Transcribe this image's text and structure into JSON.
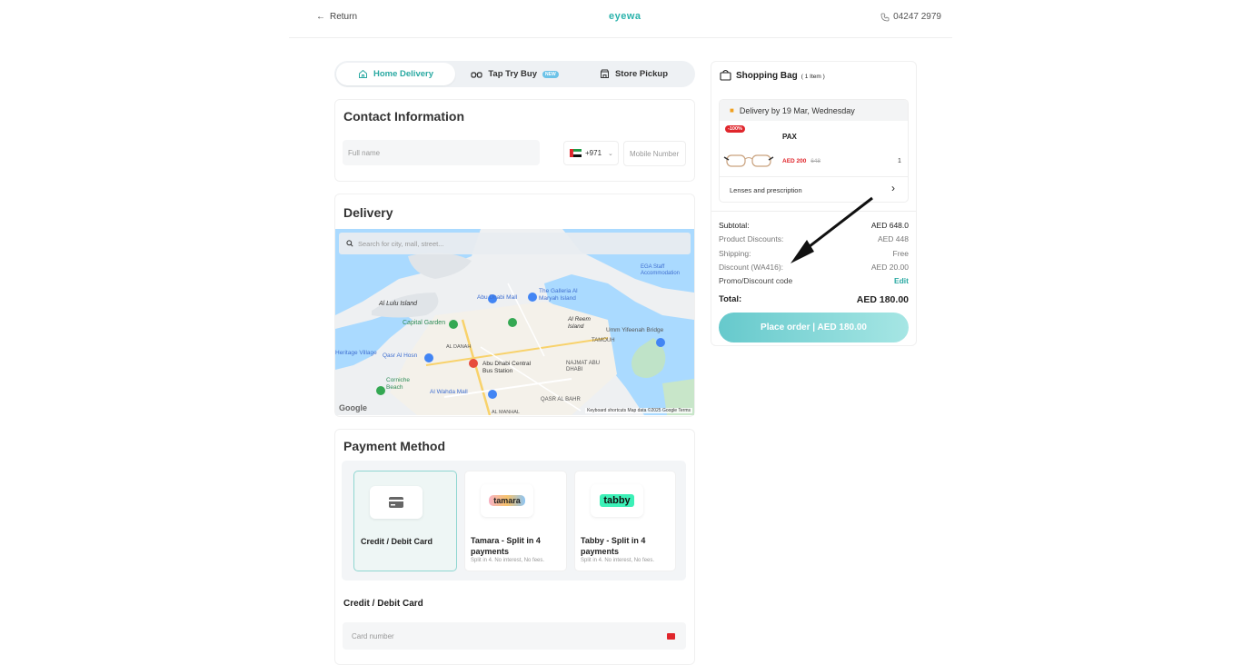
{
  "header": {
    "return_label": "Return",
    "logo": "eyewa",
    "phone": "04247 2979"
  },
  "tabs": [
    {
      "label": "Home Delivery",
      "icon": "home-icon",
      "active": true
    },
    {
      "label": "Tap Try Buy",
      "icon": "glasses-icon",
      "badge": "NEW",
      "active": false
    },
    {
      "label": "Store Pickup",
      "icon": "store-icon",
      "active": false
    }
  ],
  "contact": {
    "title": "Contact Information",
    "fullname_placeholder": "Full name",
    "country_code": "+971",
    "mobile_placeholder": "Mobile Number"
  },
  "delivery": {
    "title": "Delivery",
    "search_placeholder": "Search for city, mall, street...",
    "map_labels": {
      "lulu": "Al Lulu Island",
      "capital": "Capital Garden",
      "galleria": "The Galleria Al Maryah Island",
      "reem": "Al Reem Island",
      "mall": "Abu Dhabi Mall",
      "bus": "Abu Dhabi Central Bus Station",
      "najmat": "NAJMAT ABU DHABI",
      "tamouh": "TAMOUH",
      "wahda": "Al Wahda Mall",
      "corniche": "Corniche Beach",
      "qasr": "QASR AL BAHR",
      "qasr_hosn": "Qasr Al Hosn",
      "umm": "Umm Yifeenah Bridge",
      "village": "Heritage Village",
      "danah": "AL DANAH",
      "manhal": "AL MANHAL",
      "eg": "EGA Staff Accommodation",
      "footer": "Keyboard shortcuts   Map data ©2025 Google   Terms",
      "google": "Google"
    }
  },
  "payment": {
    "title": "Payment Method",
    "options": [
      {
        "label": "Credit / Debit Card",
        "sub": "",
        "active": true
      },
      {
        "label": "Tamara - Split in 4 payments",
        "brand": "tamara",
        "sub": "Split in 4. No interest, No fees."
      },
      {
        "label": "Tabby - Split in 4 payments",
        "brand": "tabby",
        "sub": "Split in 4. No interest, No fees."
      }
    ],
    "card_title": "Credit / Debit Card",
    "card_placeholder": "Card number"
  },
  "bag": {
    "title": "Shopping Bag",
    "count": "( 1 Item )",
    "delivery_by": "Delivery by 19 Mar, Wednesday",
    "item": {
      "discount_badge": "-100%",
      "name": "PAX",
      "price": "AED 200",
      "old_price": "648",
      "qty": "1"
    },
    "lenses": "Lenses and prescription"
  },
  "summary": {
    "subtotal_label": "Subtotal:",
    "subtotal": "AED 648.0",
    "product_discounts_label": "Product Discounts:",
    "product_discounts": "AED 448",
    "shipping_label": "Shipping:",
    "shipping": "Free",
    "discount_label": "Discount (WA416):",
    "discount": "AED 20.00",
    "promo_label": "Promo/Discount code",
    "promo_action": "Edit",
    "total_label": "Total:",
    "total": "AED 180.00",
    "place_order": "Place order | AED 180.00"
  },
  "colors": {
    "accent": "#2aa9a2",
    "sale_red": "#e0262c"
  }
}
